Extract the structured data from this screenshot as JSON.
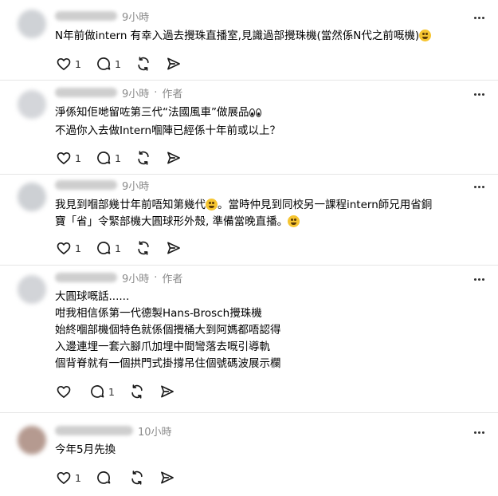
{
  "posts": [
    {
      "username": "",
      "time": "9小時",
      "author_tag": "",
      "lines": [
        {
          "text": "N年前做intern 有幸入過去攪珠直播室,見識過部攪珠機(當然係N代之前嘅機)",
          "emoji_after": "grin"
        }
      ],
      "like_count": "1",
      "reply_count": "1"
    },
    {
      "username": "",
      "time": "9小時",
      "author_tag": "作者",
      "lines": [
        {
          "text": "淨係知佢哋留咗第三代“法國風車”做展品",
          "emoji_after": "eyes"
        },
        {
          "text": "不過你入去做Intern嗰陣已經係十年前或以上？",
          "emoji_after": ""
        }
      ],
      "like_count": "1",
      "reply_count": "1"
    },
    {
      "username": "",
      "time": "9小時",
      "author_tag": "",
      "lines": [
        {
          "text": "我見到嗰部幾廿年前唔知第幾代",
          "emoji_after": "grin",
          "text_after": "。當時仲見到同校另一課程intern師兄用省銅"
        },
        {
          "text": "寶「省」令緊部機大圓球形外殼, 準備當晚直播。",
          "emoji_after": "laugh"
        }
      ],
      "like_count": "1",
      "reply_count": "1"
    },
    {
      "username": "",
      "time": "9小時",
      "author_tag": "作者",
      "lines": [
        {
          "text": "大圓球嘅話......",
          "emoji_after": ""
        },
        {
          "text": "咁我相信係第一代德製Hans-Brosch攪珠機",
          "emoji_after": ""
        },
        {
          "text": "始終嗰部機個特色就係個攪桶大到阿媽都唔認得",
          "emoji_after": ""
        },
        {
          "text": "入邊連埋一套六腳爪加埋中間彎落去嘅引導軌",
          "emoji_after": ""
        },
        {
          "text": "個背脊就有一個拱門式掛撐吊住個號碼波展示欄",
          "emoji_after": ""
        }
      ],
      "like_count": "",
      "reply_count": "1"
    },
    {
      "username": "",
      "time": "10小時",
      "author_tag": "",
      "lines": [
        {
          "text": "今年5月先換",
          "emoji_after": ""
        }
      ],
      "like_count": "1",
      "reply_count": ""
    }
  ],
  "separator": "·",
  "icons": [
    "heart-icon",
    "comment-icon",
    "repost-icon",
    "share-icon",
    "more-icon"
  ],
  "colors": {
    "text": "#000000",
    "muted": "#8b8b8b",
    "icon": "#1a1a1a",
    "divider": "#e6e6e6"
  }
}
